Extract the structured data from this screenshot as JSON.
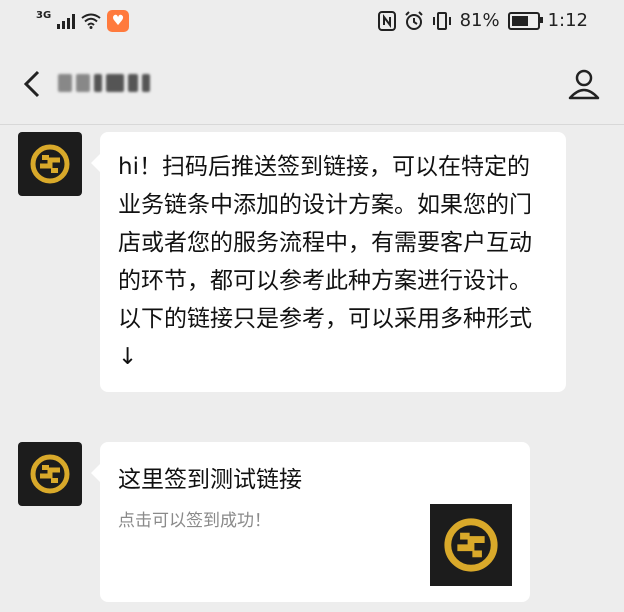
{
  "status_bar": {
    "network_label": "3G",
    "battery_text": "81%",
    "battery_level": 0.81,
    "time": "1:12",
    "icons": [
      "signal-icon",
      "wifi-icon",
      "app-badge-icon",
      "nfc-icon",
      "alarm-icon",
      "vibrate-icon",
      "battery-icon"
    ]
  },
  "nav": {
    "back_icon": "chevron-left-icon",
    "profile_icon": "person-icon"
  },
  "messages": [
    {
      "type": "text",
      "text": "hi！扫码后推送签到链接，可以在特定的业务链条中添加的设计方案。如果您的门店或者您的服务流程中，有需要客户互动的环节，都可以参考此种方案进行设计。以下的链接只是参考，可以采用多种形式 ↓"
    },
    {
      "type": "link",
      "title": "这里签到测试链接",
      "description": "点击可以签到成功！"
    }
  ],
  "colors": {
    "background": "#ededed",
    "bubble": "#ffffff",
    "logo_gold": "#d9a92a",
    "logo_bg": "#1c1c1c"
  }
}
